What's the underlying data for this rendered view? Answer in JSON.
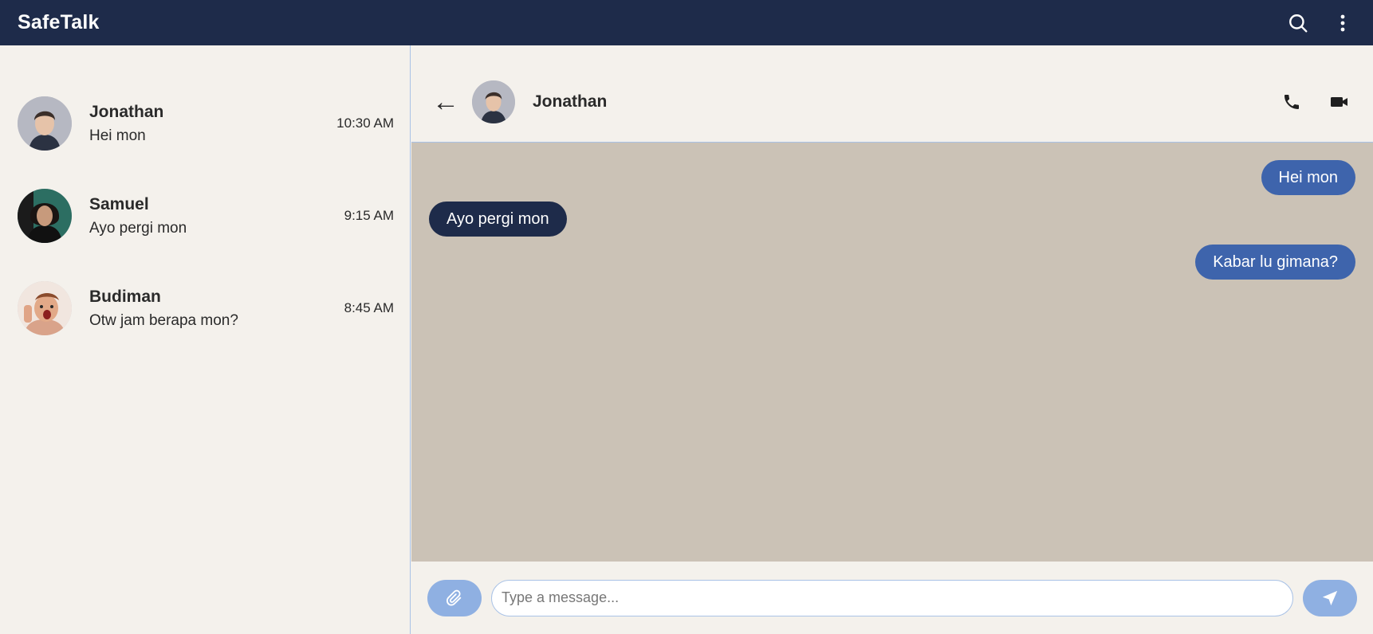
{
  "app": {
    "title": "SafeTalk"
  },
  "topbar": {
    "search_icon": "search-icon",
    "menu_icon": "more-vertical-icon"
  },
  "chats": [
    {
      "name": "Jonathan",
      "preview": "Hei mon",
      "time": "10:30 AM"
    },
    {
      "name": "Samuel",
      "preview": "Ayo pergi mon",
      "time": "9:15 AM"
    },
    {
      "name": "Budiman",
      "preview": "Otw jam berapa mon?",
      "time": "8:45 AM"
    }
  ],
  "active_chat": {
    "name": "Jonathan",
    "back_symbol": "←",
    "messages": [
      {
        "direction": "out",
        "text": "Hei mon"
      },
      {
        "direction": "in",
        "text": "Ayo pergi mon"
      },
      {
        "direction": "out",
        "text": "Kabar lu gimana?"
      }
    ]
  },
  "composer": {
    "placeholder": "Type a message..."
  },
  "colors": {
    "topbar": "#1e2b4a",
    "outgoing_bubble": "#3e64ac",
    "incoming_bubble": "#1e2b4a",
    "chat_background": "#cbc2b6",
    "button": "#8fb0e2"
  }
}
